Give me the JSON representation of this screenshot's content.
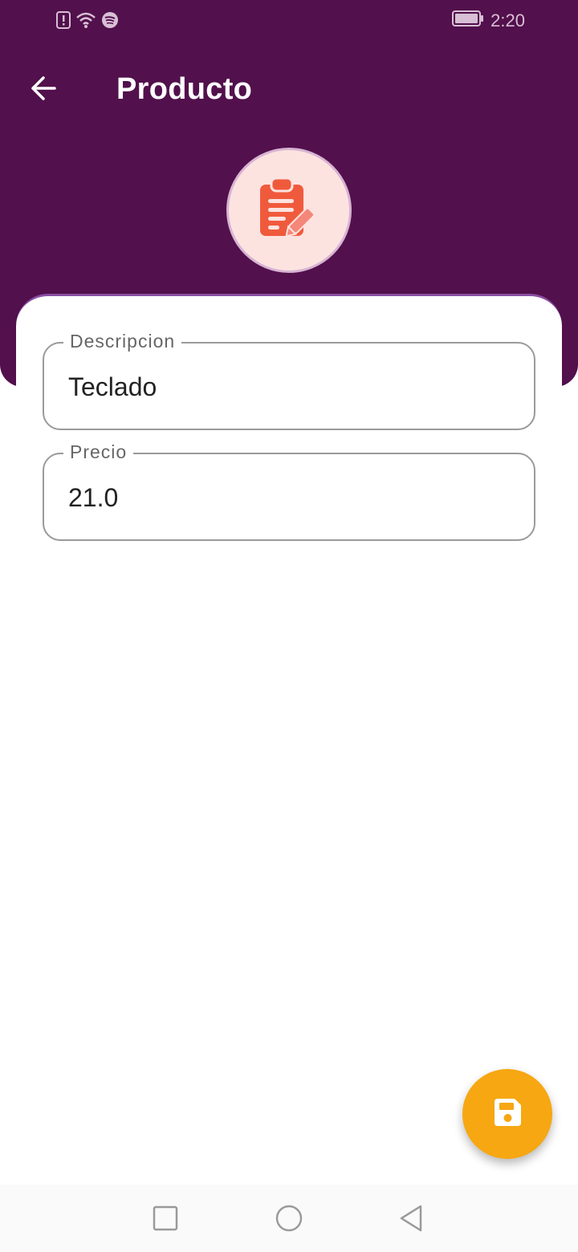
{
  "status_bar": {
    "time": "2:20",
    "icons": [
      "alert-icon",
      "wifi-icon",
      "spotify-icon",
      "battery-icon"
    ]
  },
  "appbar": {
    "title": "Producto",
    "back_icon": "arrow-left-icon"
  },
  "header": {
    "avatar_icon": "clipboard-edit-icon"
  },
  "form": {
    "descripcion": {
      "label": "Descripcion",
      "value": "Teclado"
    },
    "precio": {
      "label": "Precio",
      "value": "21.0"
    }
  },
  "fab": {
    "icon": "save-icon"
  },
  "nav": {
    "square": "recent-apps-icon",
    "circle": "home-icon",
    "triangle": "back-nav-icon"
  },
  "colors": {
    "header": "#52104c",
    "accent": "#f6a712",
    "avatar_bg": "#fde3e0",
    "icon_red": "#f05a3c"
  }
}
